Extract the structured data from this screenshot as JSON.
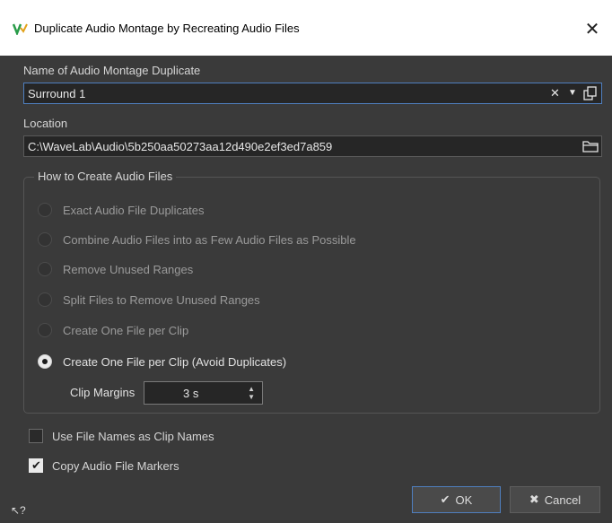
{
  "window": {
    "title": "Duplicate Audio Montage by Recreating Audio Files",
    "app_icon": "wavelab-icon",
    "close_glyph": "✕"
  },
  "name_section": {
    "label": "Name of Audio Montage Duplicate",
    "value": "Surround 1",
    "clear_glyph": "✕",
    "dropdown_glyph": "▼",
    "menu_icon": "copy-icon"
  },
  "location_section": {
    "label": "Location",
    "value": "C:\\WaveLab\\Audio\\5b250aa50273aa12d490e2ef3ed7a859",
    "folder_icon": "folder-icon"
  },
  "how_group": {
    "title": "How to Create Audio Files",
    "options": [
      {
        "label": "Exact Audio File Duplicates",
        "selected": false
      },
      {
        "label": "Combine Audio Files into as Few Audio Files as Possible",
        "selected": false
      },
      {
        "label": "Remove Unused Ranges",
        "selected": false
      },
      {
        "label": "Split Files to Remove Unused Ranges",
        "selected": false
      },
      {
        "label": "Create One File per Clip",
        "selected": false
      },
      {
        "label": "Create One File per Clip (Avoid Duplicates)",
        "selected": true
      }
    ],
    "clip_margins": {
      "label": "Clip Margins",
      "value": "3 s"
    }
  },
  "checkboxes": [
    {
      "label": "Use File Names as Clip Names",
      "checked": false
    },
    {
      "label": "Copy Audio File Markers",
      "checked": true
    }
  ],
  "buttons": {
    "ok": "OK",
    "cancel": "Cancel",
    "ok_icon": "✔",
    "cancel_icon": "✖"
  },
  "help_glyph": "↖?",
  "colors": {
    "accent": "#4f7fbf",
    "background": "#3a3a3a",
    "field": "#262626"
  }
}
